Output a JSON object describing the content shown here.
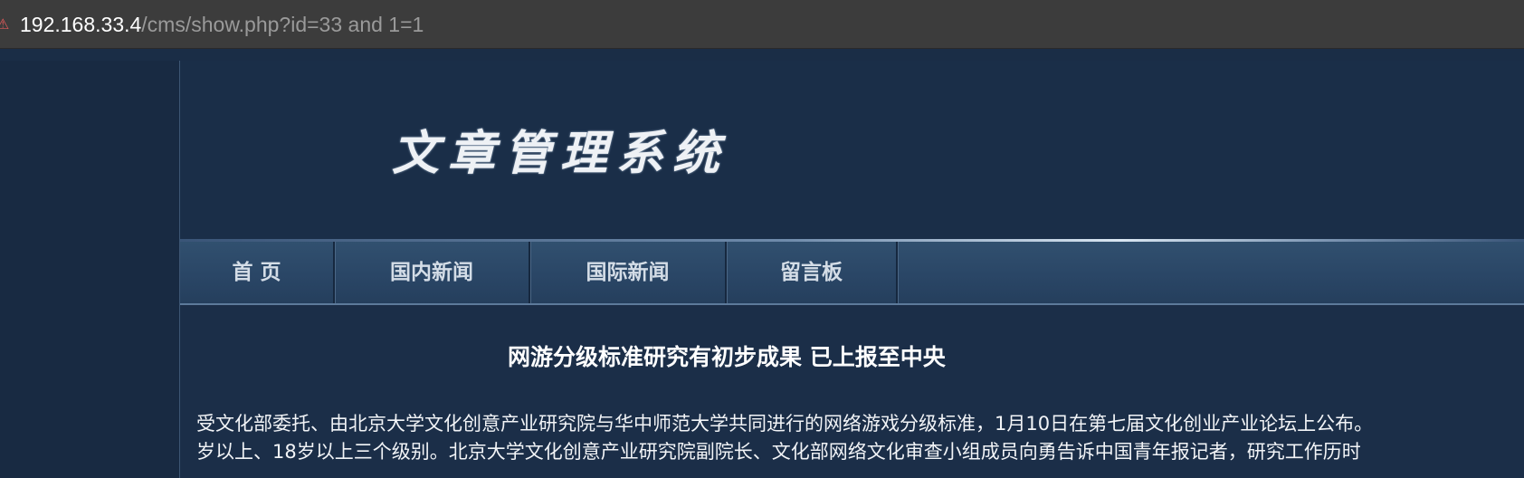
{
  "browser": {
    "url_host": "192.168.33.4",
    "url_path": "/cms/show.php?id=33 and 1=1",
    "warning_icon": "not-secure-icon"
  },
  "site": {
    "logo_title": "文章管理系统"
  },
  "nav": {
    "items": [
      {
        "label": "首 页"
      },
      {
        "label": "国内新闻"
      },
      {
        "label": "国际新闻"
      },
      {
        "label": "留言板"
      }
    ]
  },
  "article": {
    "title": "网游分级标准研究有初步成果 已上报至中央",
    "lines": [
      "受文化部委托、由北京大学文化创意产业研究院与华中师范大学共同进行的网络游戏分级标准，1月10日在第七届文化创业产业论坛上公布。",
      "岁以上、18岁以上三个级别。北京大学文化创意产业研究院副院长、文化部网络文化审查小组成员向勇告诉中国青年报记者，研究工作历时"
    ]
  },
  "colors": {
    "page_bg": "#1a2d46",
    "nav_bg": "#2a4666",
    "urlbar_bg": "#3c3c3c"
  }
}
